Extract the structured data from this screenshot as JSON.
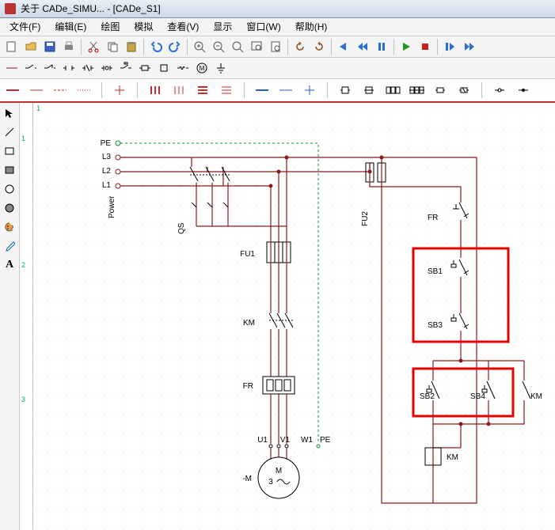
{
  "title": "关于 CADe_SIMU... - [CADe_S1]",
  "menu": {
    "file": "文件(F)",
    "edit": "编辑(E)",
    "draw": "绘图",
    "sim": "模拟",
    "view": "查看(V)",
    "display": "显示",
    "window": "窗口(W)",
    "help": "帮助(H)"
  },
  "labels": {
    "PE": "PE",
    "L3": "L3",
    "L2": "L2",
    "L1": "L1",
    "Power": "Power",
    "QS": "QS",
    "FU1": "FU1",
    "FU2": "FU2",
    "FR": "FR",
    "KM": "KM",
    "SB1": "SB1",
    "SB2": "SB2",
    "SB3": "SB3",
    "SB4": "SB4",
    "U1": "U1",
    "V1": "V1",
    "W1": "W1",
    "M": "M",
    "M3": "3",
    "Mneg": "-M"
  },
  "ruler": {
    "h1": "1",
    "v1": "1",
    "v2": "2",
    "v3": "3"
  }
}
